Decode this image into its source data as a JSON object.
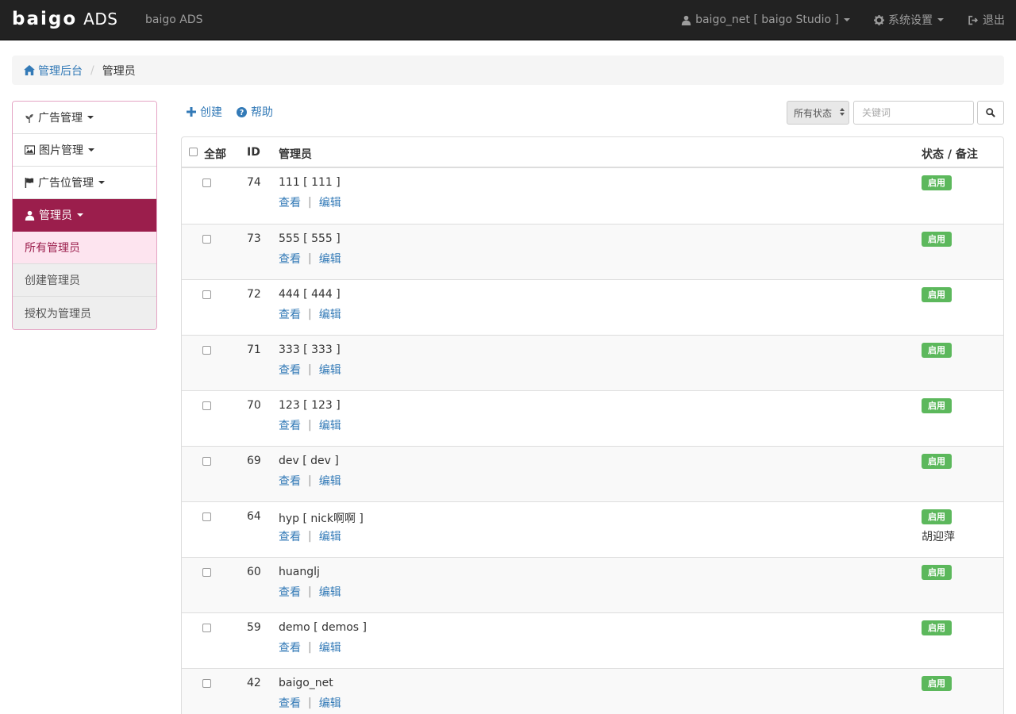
{
  "navbar": {
    "logo_text": "baigo",
    "logo_suffix": "ADS",
    "site_name": "baigo ADS",
    "user_label": "baigo_net [ baigo Studio ]",
    "settings_label": "系统设置",
    "logout_label": "退出"
  },
  "breadcrumb": {
    "home": "管理后台",
    "current": "管理员"
  },
  "sidebar": {
    "items": [
      {
        "label": "广告管理",
        "icon": "leaf-icon"
      },
      {
        "label": "图片管理",
        "icon": "picture-icon"
      },
      {
        "label": "广告位管理",
        "icon": "flag-icon"
      },
      {
        "label": "管理员",
        "icon": "user-icon"
      }
    ],
    "sub_items": [
      {
        "label": "所有管理员"
      },
      {
        "label": "创建管理员"
      },
      {
        "label": "授权为管理员"
      }
    ]
  },
  "toolbar": {
    "create_label": "创建",
    "help_label": "帮助",
    "status_select": "所有状态",
    "keyword_placeholder": "关键词"
  },
  "table": {
    "headers": {
      "all": "全部",
      "id": "ID",
      "admin": "管理员",
      "status": "状态 / 备注"
    },
    "view_label": "查看",
    "edit_label": "编辑",
    "rows": [
      {
        "id": "74",
        "name": "111 [ 111 ]",
        "status": "启用",
        "note": ""
      },
      {
        "id": "73",
        "name": "555 [ 555 ]",
        "status": "启用",
        "note": ""
      },
      {
        "id": "72",
        "name": "444 [ 444 ]",
        "status": "启用",
        "note": ""
      },
      {
        "id": "71",
        "name": "333 [ 333 ]",
        "status": "启用",
        "note": ""
      },
      {
        "id": "70",
        "name": "123 [ 123 ]",
        "status": "启用",
        "note": ""
      },
      {
        "id": "69",
        "name": "dev [ dev ]",
        "status": "启用",
        "note": ""
      },
      {
        "id": "64",
        "name": "hyp [ nick啊啊 ]",
        "status": "启用",
        "note": "胡迎萍"
      },
      {
        "id": "60",
        "name": "huanglj",
        "status": "启用",
        "note": ""
      },
      {
        "id": "59",
        "name": "demo [ demos ]",
        "status": "启用",
        "note": ""
      },
      {
        "id": "42",
        "name": "baigo_net",
        "status": "启用",
        "note": ""
      }
    ]
  },
  "colors": {
    "navbar_bg": "#222222",
    "accent": "#9b1e4c",
    "link": "#337ab7",
    "badge_success": "#5cb85c"
  }
}
